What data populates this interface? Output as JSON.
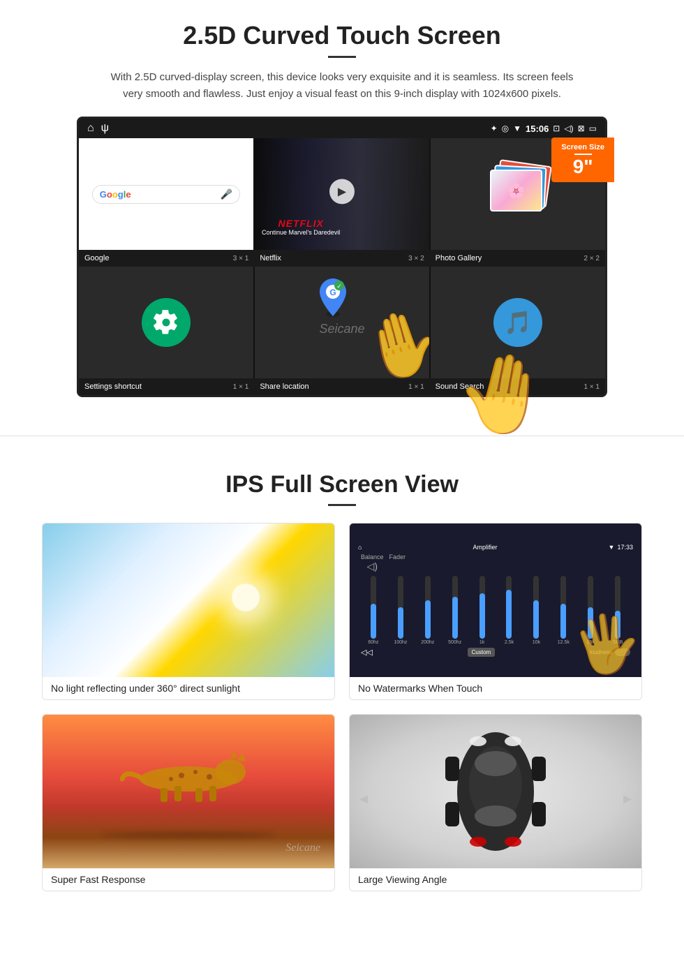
{
  "section1": {
    "title": "2.5D Curved Touch Screen",
    "description": "With 2.5D curved-display screen, this device looks very exquisite and it is seamless. Its screen feels very smooth and flawless. Just enjoy a visual feast on this 9-inch display with 1024x600 pixels.",
    "screen_size_label": "Screen Size",
    "screen_size_value": "9\"",
    "status_bar": {
      "time": "15:06"
    },
    "apps": {
      "row1": [
        {
          "name": "Google",
          "size": "3 × 1"
        },
        {
          "name": "Netflix",
          "size": "3 × 2"
        },
        {
          "name": "Photo Gallery",
          "size": "2 × 2"
        }
      ],
      "row2": [
        {
          "name": "Settings shortcut",
          "size": "1 × 1"
        },
        {
          "name": "Share location",
          "size": "1 × 1"
        },
        {
          "name": "Sound Search",
          "size": "1 × 1"
        }
      ]
    },
    "netflix": {
      "logo": "NETFLIX",
      "subtitle": "Continue Marvel's Daredevil"
    },
    "watermark": "Seicane"
  },
  "section2": {
    "title": "IPS Full Screen View",
    "images": [
      {
        "type": "sunlight",
        "caption": "No light reflecting under 360° direct sunlight"
      },
      {
        "type": "amplifier",
        "caption": "No Watermarks When Touch"
      },
      {
        "type": "cheetah",
        "caption": "Super Fast Response"
      },
      {
        "type": "car",
        "caption": "Large Viewing Angle"
      }
    ],
    "amp": {
      "title": "Amplifier",
      "time": "17:33",
      "labels": [
        "60hz",
        "100hz",
        "200hz",
        "500hz",
        "1k",
        "2.5k",
        "10k",
        "12.5k",
        "15k",
        "SUB"
      ],
      "heights": [
        50,
        45,
        55,
        60,
        65,
        70,
        55,
        50,
        45,
        40
      ],
      "custom_label": "Custom",
      "loudness_label": "loudness"
    }
  }
}
